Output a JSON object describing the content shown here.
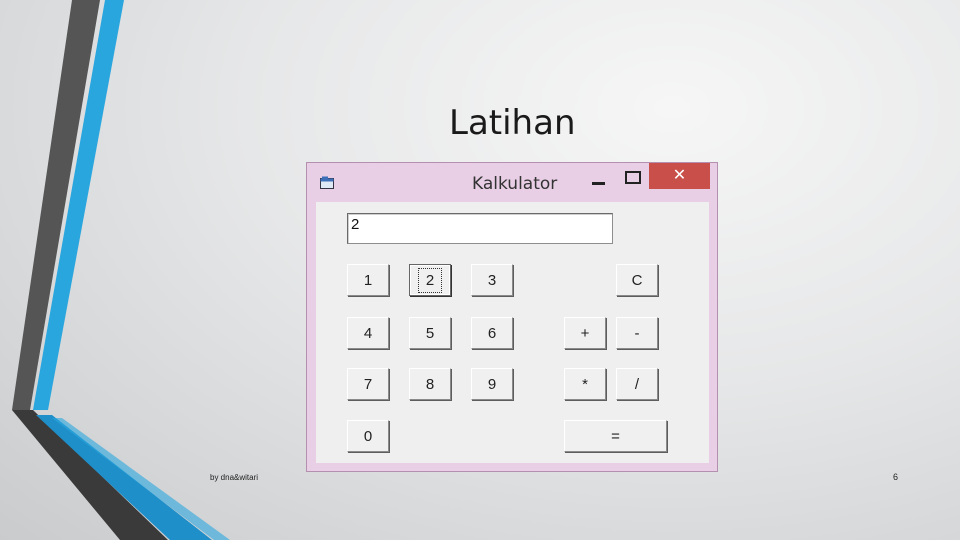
{
  "slide": {
    "title": "Latihan",
    "footer_author": "by dna&witari",
    "page_number": "6"
  },
  "window": {
    "title": "Kalkulator",
    "close_label": "✕",
    "display_value": "2"
  },
  "buttons": {
    "one": "1",
    "two": "2",
    "three": "3",
    "clear": "C",
    "four": "4",
    "five": "5",
    "six": "6",
    "plus": "+",
    "minus": "-",
    "seven": "7",
    "eight": "8",
    "nine": "9",
    "multiply": "*",
    "divide": "/",
    "zero": "0",
    "equals": "="
  },
  "focused_button": "2",
  "colors": {
    "window_frame": "#e8cfe5",
    "close_button": "#c9504a",
    "stripe_blue": "#29a8e0",
    "stripe_gray": "#5a5a5a"
  }
}
